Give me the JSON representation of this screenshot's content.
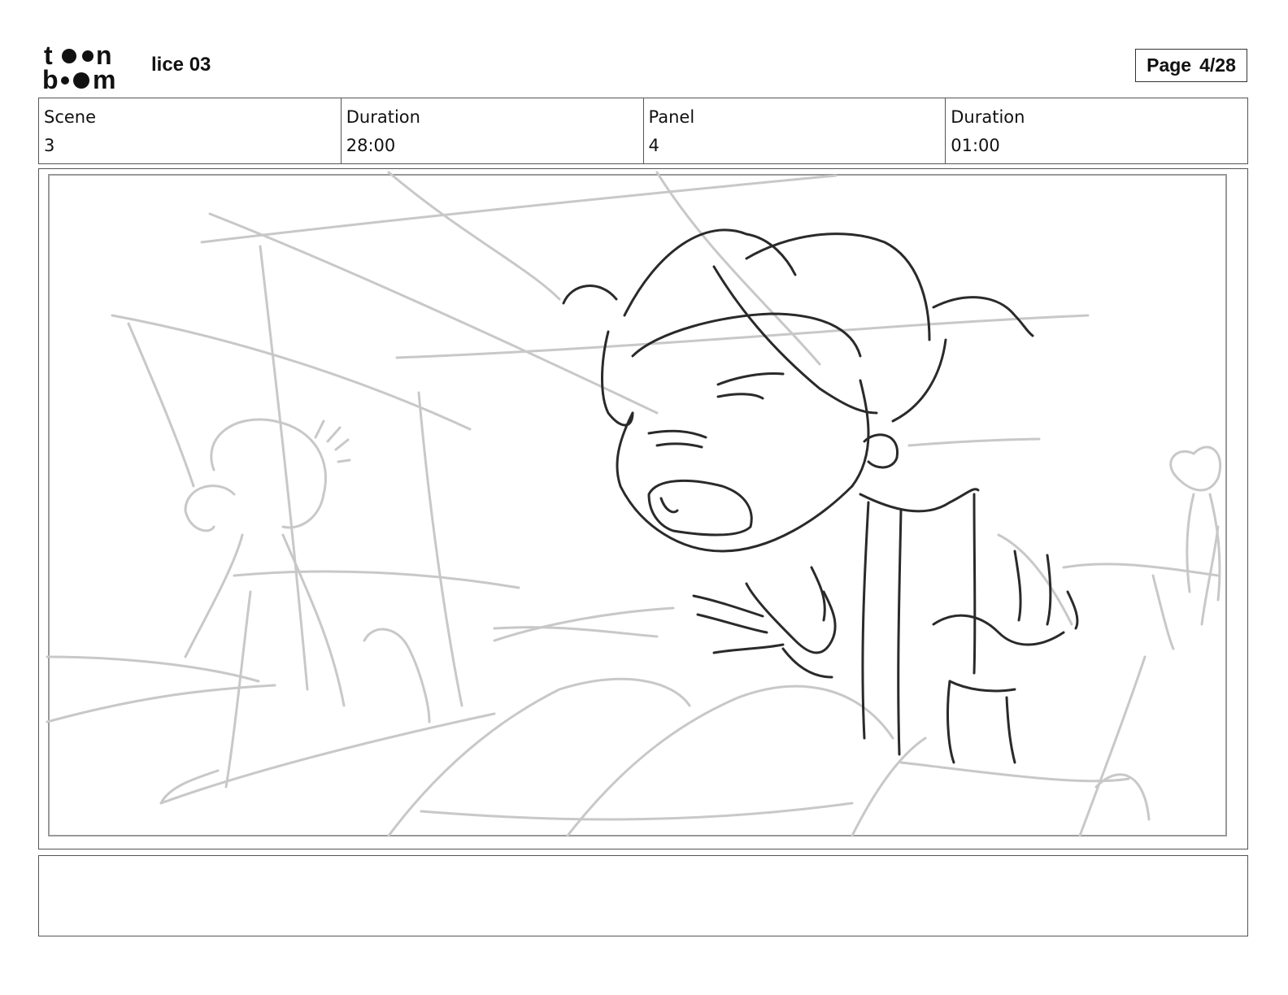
{
  "header": {
    "logo_text": [
      "t",
      "n",
      "b",
      "m"
    ],
    "project_title": "lice 03",
    "page_label": "Page",
    "page_number": "4/28"
  },
  "info": {
    "scene_label": "Scene",
    "scene_value": "3",
    "scene_duration_label": "Duration",
    "scene_duration_value": "28:00",
    "panel_label": "Panel",
    "panel_value": "4",
    "panel_duration_label": "Duration",
    "panel_duration_value": "01:00"
  },
  "notes": {
    "text": ""
  },
  "colors": {
    "rough_sketch": "#c8c8c8",
    "clean_sketch": "#2a2a2a",
    "border": "#555555"
  }
}
